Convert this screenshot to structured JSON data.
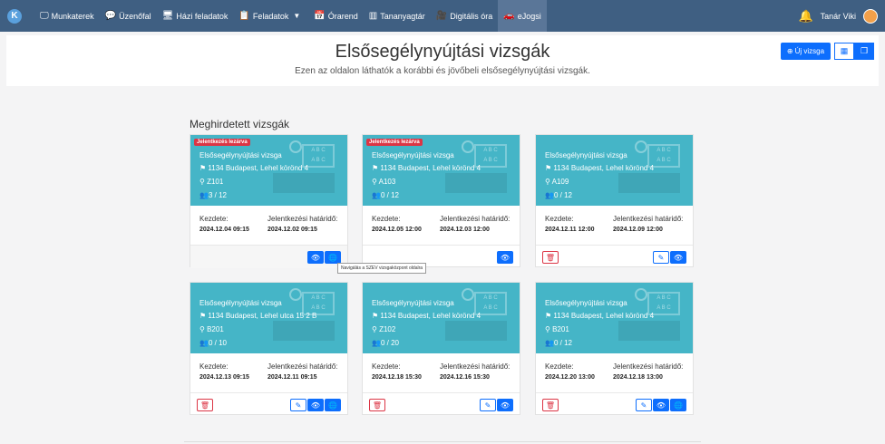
{
  "nav": {
    "items": [
      {
        "icon": "🖵",
        "label": "Munkaterek"
      },
      {
        "icon": "💬",
        "label": "Üzenőfal"
      },
      {
        "icon": "🖥",
        "label": "Házi feladatok"
      },
      {
        "icon": "📋",
        "label": "Feladatok"
      },
      {
        "icon": "📅",
        "label": "Órarend"
      },
      {
        "icon": "▥",
        "label": "Tananyagtár"
      },
      {
        "icon": "🎥",
        "label": "Digitális óra"
      },
      {
        "icon": "🚗",
        "label": "eJogsi"
      }
    ],
    "user": "Tanár Viki",
    "dropdown_icon": "▼"
  },
  "header": {
    "title": "Elsősegélynyújtási vizsgák",
    "subtitle": "Ezen az oldalon láthatók a korábbi és jövőbeli elsősegélynyújtási vizsgák.",
    "new_button": "Új vizsga"
  },
  "section_title": "Meghirdetett vizsgák",
  "labels": {
    "start": "Kezdete:",
    "deadline": "Jelentkezési határidő:",
    "badge": "Jelentkezés lezárva"
  },
  "tooltip": "Navigálás a SZEV vizsgaközpont oldalra",
  "cards": [
    {
      "title": "Elsősegélynyújtási vizsga",
      "address": "1134 Budapest, Lehel körönd 4",
      "room": "Z101",
      "count": "3 / 12",
      "start": "2024.12.04 09:15",
      "deadline": "2024.12.02 09:15",
      "closed": true
    },
    {
      "title": "Elsősegélynyújtási vizsga",
      "address": "1134 Budapest, Lehel körönd 4",
      "room": "A103",
      "count": "0 / 12",
      "start": "2024.12.05 12:00",
      "deadline": "2024.12.03 12:00",
      "closed": true
    },
    {
      "title": "Elsősegélynyújtási vizsga",
      "address": "1134 Budapest, Lehel körönd 4",
      "room": "A109",
      "count": "0 / 12",
      "start": "2024.12.11 12:00",
      "deadline": "2024.12.09 12:00",
      "closed": false
    },
    {
      "title": "Elsősegélynyújtási vizsga",
      "address": "1134 Budapest, Lehel utca 15 2 B",
      "room": "B201",
      "count": "0 / 10",
      "start": "2024.12.13 09:15",
      "deadline": "2024.12.11 09:15",
      "closed": false
    },
    {
      "title": "Elsősegélynyújtási vizsga",
      "address": "1134 Budapest, Lehel körönd 4",
      "room": "Z102",
      "count": "0 / 20",
      "start": "2024.12.18 15:30",
      "deadline": "2024.12.16 15:30",
      "closed": false
    },
    {
      "title": "Elsősegélynyújtási vizsga",
      "address": "1134 Budapest, Lehel körönd 4",
      "room": "B201",
      "count": "0 / 12",
      "start": "2024.12.20 13:00",
      "deadline": "2024.12.18 13:00",
      "closed": false
    }
  ]
}
